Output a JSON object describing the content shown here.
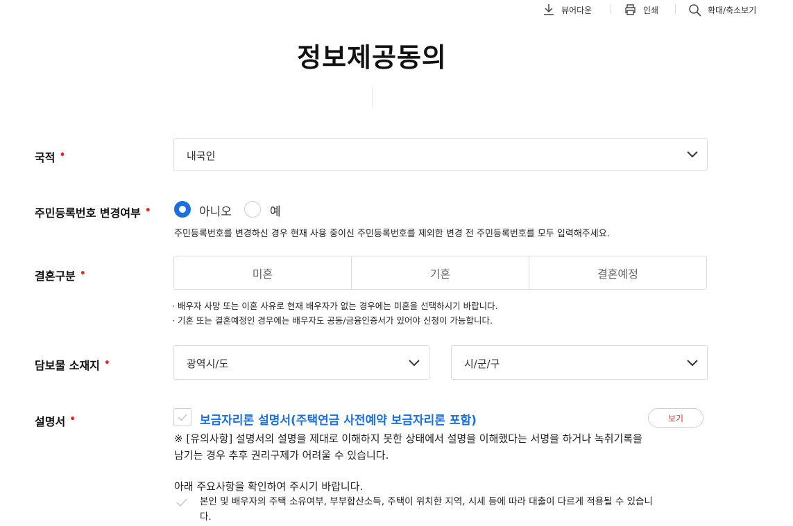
{
  "toolbar": {
    "viewer_download": "뷰어다운",
    "print": "인쇄",
    "zoom": "확대/축소보기"
  },
  "page_title": "정보제공동의",
  "nationality": {
    "label": "국적",
    "required_mark": "•",
    "value": "내국인"
  },
  "rrn_change": {
    "label": "주민등록번호 변경여부",
    "required_mark": "•",
    "options": [
      {
        "label": "아니오",
        "selected": true
      },
      {
        "label": "예",
        "selected": false
      }
    ],
    "note": "주민등록번호를 변경하신 경우 현재 사용 중이신 주민등록번호를 제외한 변경 전 주민등록번호를 모두 입력해주세요."
  },
  "marriage": {
    "label": "결혼구분",
    "required_mark": "•",
    "options": [
      "미혼",
      "기혼",
      "결혼예정"
    ],
    "notes": [
      "· 배우자 사망 또는 이혼 사유로 현재 배우자가 없는 경우에는 미혼을 선택하시기 바랍니다.",
      "· 기혼 또는 결혼예정인 경우에는 배우자도 공동/금융인증서가 있어야 신청이 가능합니다."
    ]
  },
  "collateral": {
    "label": "담보물 소재지",
    "required_mark": "•",
    "province_placeholder": "광역시/도",
    "city_placeholder": "시/군/구"
  },
  "manual": {
    "label": "설명서",
    "required_mark": "•",
    "doc_name": "보금자리론 설명서(주택연금 사전예약 보금자리론 포함)",
    "view_button": "보기",
    "caution_line1": "※ [유의사항] 설명서의 설명을 제대로 이해하지 못한 상태에서 설명을 이해했다는 서명을 하거나 녹취기록을",
    "caution_line2": "남기는 경우 추후 권리구제가 어려울 수 있습니다.",
    "confirm_intro": "아래 주요사항을 확인하여 주시기 바랍니다.",
    "item1_line1": "본인 및 배우자의 주택 소유여부, 부부합산소득, 주택이 위치한 지역, 시세 등에 따라 대출이 다르게 적용될 수 있습니",
    "item1_line2": "다."
  },
  "colors": {
    "accent": "#1b6fe0",
    "required": "#e5262b",
    "border": "#dcdcdc"
  }
}
